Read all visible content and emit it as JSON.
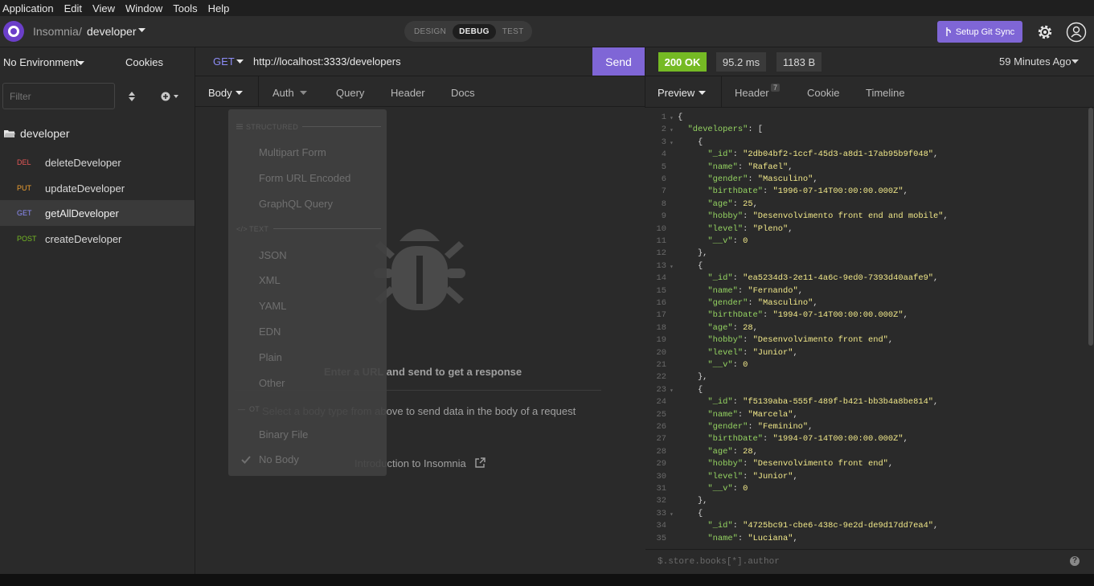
{
  "menubar": [
    "Application",
    "Edit",
    "View",
    "Window",
    "Tools",
    "Help"
  ],
  "header": {
    "app_name": "Insomnia",
    "separator": "/",
    "workspace": "developer",
    "modes": [
      "DESIGN",
      "DEBUG",
      "TEST"
    ],
    "active_mode": "DEBUG",
    "git_sync_label": "Setup Git Sync"
  },
  "sidebar": {
    "environment": "No Environment",
    "cookies": "Cookies",
    "filter_placeholder": "Filter",
    "folder": "developer",
    "requests": [
      {
        "method": "DEL",
        "name": "deleteDeveloper",
        "color": "#e65757"
      },
      {
        "method": "PUT",
        "name": "updateDeveloper",
        "color": "#f0a030"
      },
      {
        "method": "GET",
        "name": "getAllDeveloper",
        "color": "#8d8df7"
      },
      {
        "method": "POST",
        "name": "createDeveloper",
        "color": "#75ba24"
      }
    ]
  },
  "request": {
    "method": "GET",
    "url": "http://localhost:3333/developers",
    "send_label": "Send",
    "tabs": [
      "Body",
      "Auth",
      "Query",
      "Header",
      "Docs"
    ],
    "empty_title": "Enter a URL and send to get a response",
    "empty_sub": "Select a body type from above to send data in the body of a request",
    "intro_link": "Introduction to Insomnia"
  },
  "body_dropdown": {
    "structured_header": "STRUCTURED",
    "structured": [
      "Multipart Form",
      "Form URL Encoded",
      "GraphQL Query"
    ],
    "text_header": "TEXT",
    "text": [
      "JSON",
      "XML",
      "YAML",
      "EDN",
      "Plain",
      "Other"
    ],
    "other_header": "OT",
    "other": [
      "Binary File",
      "No Body"
    ]
  },
  "response": {
    "status": "200 OK",
    "time": "95.2 ms",
    "size": "1183 B",
    "ago": "59 Minutes Ago",
    "tabs": [
      "Preview",
      "Header",
      "Cookie",
      "Timeline"
    ],
    "header_count": "7",
    "filter_placeholder": "$.store.books[*].author",
    "help": "?",
    "code_lines": [
      "{",
      "  \"developers\": [",
      "    {",
      "      \"_id\": \"2db04bf2-1ccf-45d3-a8d1-17ab95b9f048\",",
      "      \"name\": \"Rafael\",",
      "      \"gender\": \"Masculino\",",
      "      \"birthDate\": \"1996-07-14T00:00:00.000Z\",",
      "      \"age\": 25,",
      "      \"hobby\": \"Desenvolvimento front end and mobile\",",
      "      \"level\": \"Pleno\",",
      "      \"__v\": 0",
      "    },",
      "    {",
      "      \"_id\": \"ea5234d3-2e11-4a6c-9ed0-7393d40aafe9\",",
      "      \"name\": \"Fernando\",",
      "      \"gender\": \"Masculino\",",
      "      \"birthDate\": \"1994-07-14T00:00:00.000Z\",",
      "      \"age\": 28,",
      "      \"hobby\": \"Desenvolvimento front end\",",
      "      \"level\": \"Junior\",",
      "      \"__v\": 0",
      "    },",
      "    {",
      "      \"_id\": \"f5139aba-555f-489f-b421-bb3b4a8be814\",",
      "      \"name\": \"Marcela\",",
      "      \"gender\": \"Feminino\",",
      "      \"birthDate\": \"1994-07-14T00:00:00.000Z\",",
      "      \"age\": 28,",
      "      \"hobby\": \"Desenvolvimento front end\",",
      "      \"level\": \"Junior\",",
      "      \"__v\": 0",
      "    },",
      "    {",
      "      \"_id\": \"4725bc91-cbe6-438c-9e2d-de9d17dd7ea4\",",
      "      \"name\": \"Luciana\","
    ]
  },
  "colors": {
    "accent": "#7f66d6",
    "status_ok": "#75ba24",
    "json_key": "#95d462",
    "json_value": "#f2e98a"
  }
}
